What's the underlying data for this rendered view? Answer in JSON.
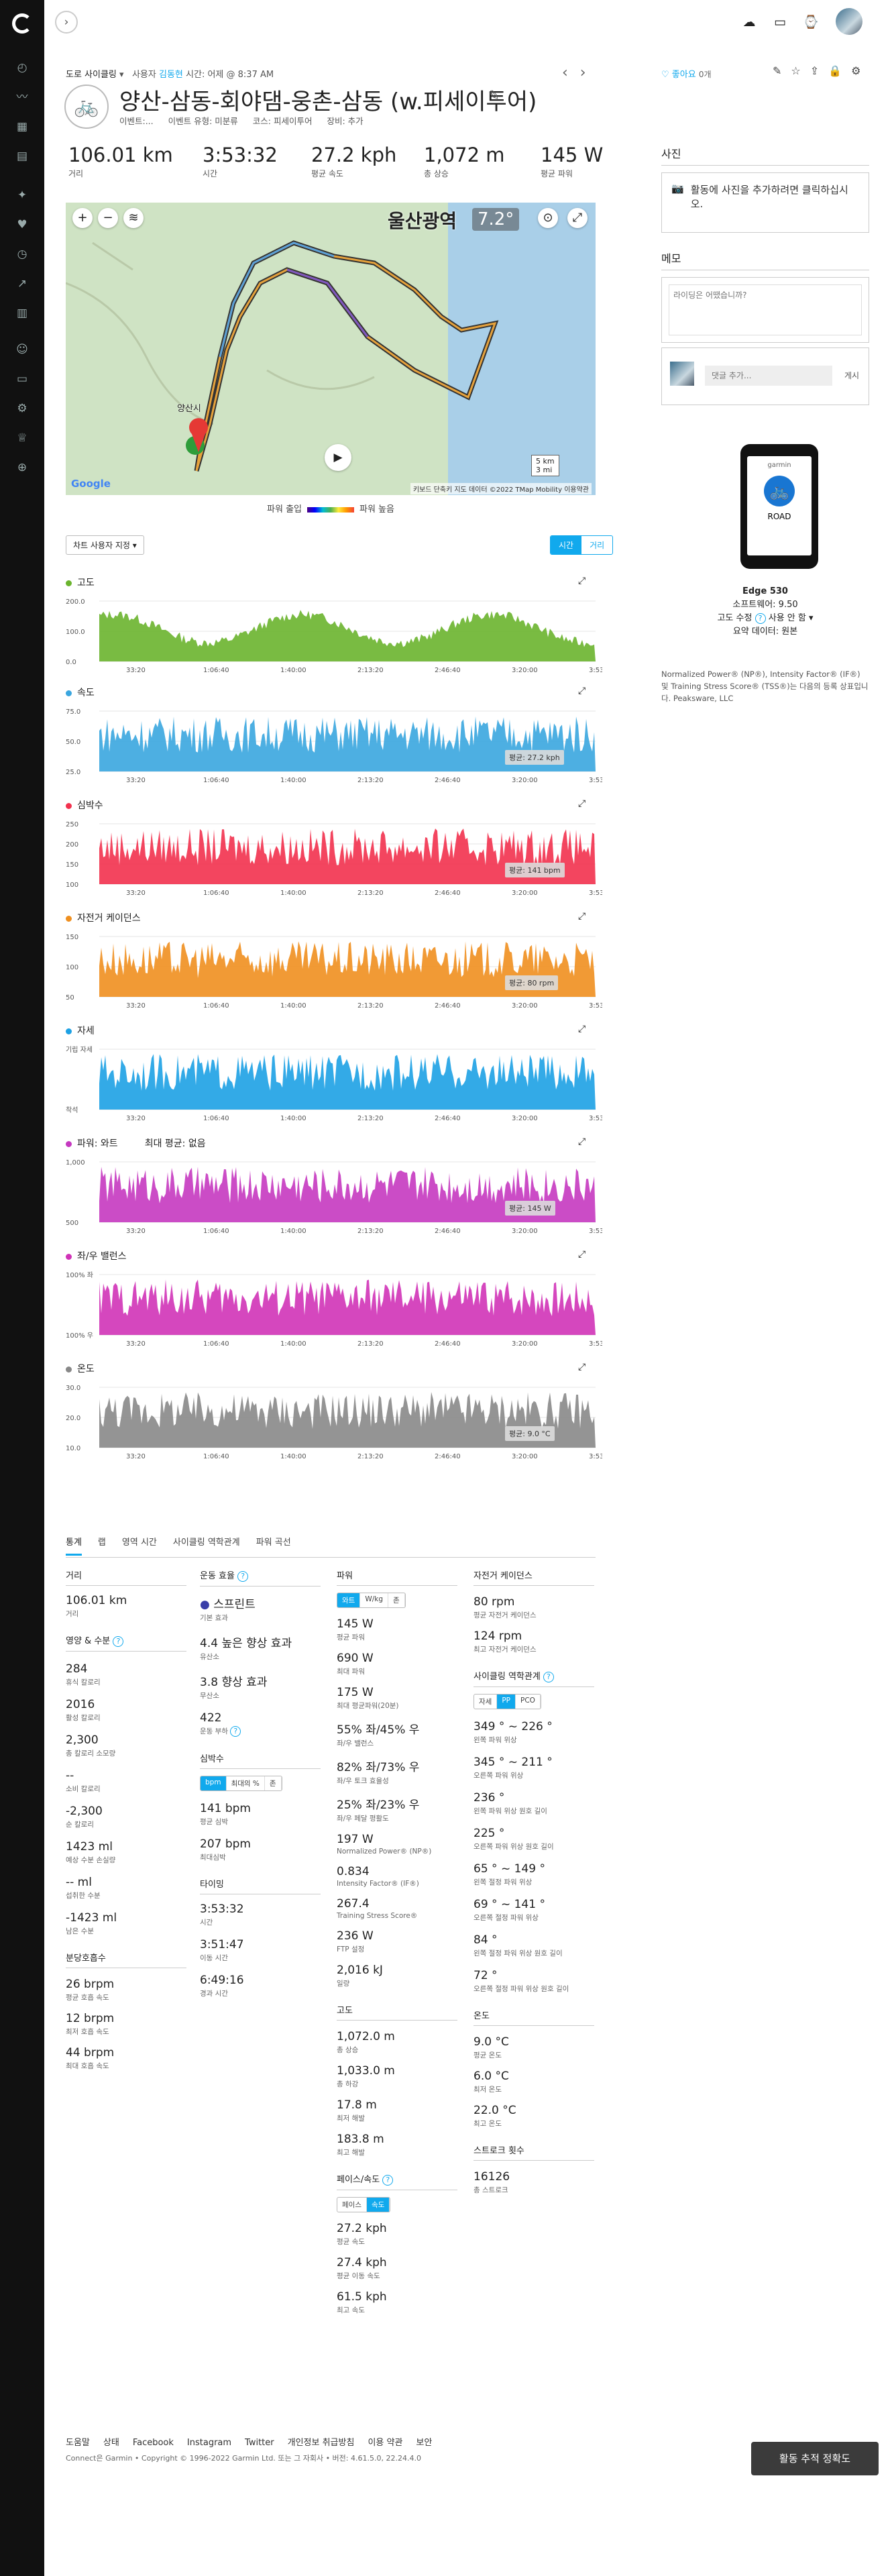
{
  "activity": {
    "breadcrumb_type": "도로 사이클링",
    "breadcrumb_user": "사용자",
    "breadcrumb_user_link": "김동현",
    "breadcrumb_time": "시간: 어제 @ 8:37 AM",
    "title": "양산-삼동-회야댐-웅촌-삼동 (w.피세이투어)",
    "sub_event": "이벤트:...",
    "sub_event_type": "이벤트 유형: 미분류",
    "sub_course": "코스: 피세이투어",
    "sub_gear": "장비: 추가",
    "like": "좋아요",
    "like_count": "0개"
  },
  "stats": [
    {
      "value": "106.01 km",
      "label": "거리"
    },
    {
      "value": "3:53:32",
      "label": "시간"
    },
    {
      "value": "27.2 kph",
      "label": "평균 속도"
    },
    {
      "value": "1,072 m",
      "label": "총 상승"
    },
    {
      "value": "145 W",
      "label": "평균 파워"
    }
  ],
  "map": {
    "city": "울산광역",
    "temp": "7.2°",
    "scale_1": "5 km",
    "scale_2": "3 mi",
    "attribution": "키보드 단축키  지도 데이터 ©2022 TMap Mobility  이용약관",
    "google": "Google",
    "place_1": "양산시",
    "legend_low": "파워 출입",
    "legend_high": "파워 높음"
  },
  "controls": {
    "user_setting": "차트 사용자 지정",
    "time": "시간",
    "distance": "거리"
  },
  "charts": [
    {
      "title": "고도",
      "color": "#6ab42d",
      "y_ticks": [
        "200.0",
        "100.0",
        "0.0"
      ],
      "avg": ""
    },
    {
      "title": "속도",
      "color": "#3aa6df",
      "y_ticks": [
        "75.0",
        "50.0",
        "25.0"
      ],
      "avg": "평균: 27.2 kph"
    },
    {
      "title": "심박수",
      "color": "#f2314e",
      "y_ticks": [
        "250",
        "200",
        "150",
        "100"
      ],
      "avg": "평균: 141 bpm"
    },
    {
      "title": "자전거 케이던스",
      "color": "#ef8f1f",
      "y_ticks": [
        "150",
        "100",
        "50"
      ],
      "avg": "평균: 80 rpm"
    },
    {
      "title": "자세",
      "color": "#1da1e4",
      "y_ticks": [
        "기립 자세",
        "착석"
      ],
      "avg": ""
    },
    {
      "title": "파워: 와트",
      "color": "#c538c0",
      "y_ticks": [
        "1,000",
        "500"
      ],
      "avg": "평균: 145 W",
      "extra": "최대 평균: 없음"
    },
    {
      "title": "좌/우 밸런스",
      "color": "#d033b7",
      "y_ticks": [
        "100% 좌",
        "100% 우"
      ],
      "avg": ""
    },
    {
      "title": "온도",
      "color": "#888888",
      "y_ticks": [
        "30.0",
        "20.0",
        "10.0"
      ],
      "avg": "평균: 9.0 °C"
    }
  ],
  "x_ticks": [
    "33:20",
    "1:06:40",
    "1:40:00",
    "2:13:20",
    "2:46:40",
    "3:20:00",
    "3:53:20"
  ],
  "tabs": [
    "통계",
    "랩",
    "영역 시간",
    "사이클링 역학관계",
    "파워 곡선"
  ],
  "col1": {
    "distance_h": "거리",
    "distance": "106.01 km",
    "distance_l": "거리",
    "nutrition_h": "영양 & 수분",
    "items": [
      {
        "v": "284",
        "l": "휴식 칼로리"
      },
      {
        "v": "2016",
        "l": "활성 칼로리"
      },
      {
        "v": "2,300",
        "l": "총 칼로리 소모량"
      },
      {
        "v": "--",
        "l": "소비 칼로리"
      },
      {
        "v": "-2,300",
        "l": "순 칼로리"
      },
      {
        "v": "1423 ml",
        "l": "예상 수분 손실량"
      },
      {
        "v": "-- ml",
        "l": "섭취한 수분"
      },
      {
        "v": "-1423 ml",
        "l": "남은 수분"
      }
    ],
    "resp_h": "분당호흡수",
    "resp": [
      {
        "v": "26 brpm",
        "l": "평균 호흡 속도"
      },
      {
        "v": "12 brpm",
        "l": "최저 호흡 속도"
      },
      {
        "v": "44 brpm",
        "l": "최대 호흡 속도"
      }
    ]
  },
  "col2": {
    "effect_h": "운동 효율",
    "effect_label": "스프린트",
    "effect_sub": "기본 효과",
    "aerobic": "4.4 높은 향상 효과",
    "aerobic_l": "유산소",
    "anaerobic": "3.8 향상 효과",
    "anaerobic_l": "무산소",
    "load": "422",
    "load_l": "운동 부하",
    "hr_h": "심박수",
    "hr_toggle": [
      "bpm",
      "최대의 %",
      "존"
    ],
    "hr_avg": "141 bpm",
    "hr_avg_l": "평균 심박",
    "hr_max": "207 bpm",
    "hr_max_l": "최대심박",
    "timing_h": "타이밍",
    "time": "3:53:32",
    "time_l": "시간",
    "moving": "3:51:47",
    "moving_l": "이동 시간",
    "elapsed": "6:49:16",
    "elapsed_l": "경과 시간"
  },
  "col3": {
    "power_h": "파워",
    "power_toggle": [
      "와트",
      "W/kg",
      "존"
    ],
    "items": [
      {
        "v": "145 W",
        "l": "평균 파워"
      },
      {
        "v": "690 W",
        "l": "최대 파워"
      },
      {
        "v": "175 W",
        "l": "최대 평균파워(20분)"
      },
      {
        "v": "55% 좌/45% 우",
        "l": "좌/우 밸런스"
      },
      {
        "v": "82% 좌/73% 우",
        "l": "좌/우 토크 효율성"
      },
      {
        "v": "25% 좌/23% 우",
        "l": "좌/우 페달 평활도"
      },
      {
        "v": "197 W",
        "l": "Normalized Power® (NP®)"
      },
      {
        "v": "0.834",
        "l": "Intensity Factor® (IF®)"
      },
      {
        "v": "267.4",
        "l": "Training Stress Score®"
      },
      {
        "v": "236 W",
        "l": "FTP 설정"
      },
      {
        "v": "2,016 kJ",
        "l": "일량"
      }
    ],
    "elev_h": "고도",
    "elev": [
      {
        "v": "1,072.0 m",
        "l": "총 상승"
      },
      {
        "v": "1,033.0 m",
        "l": "총 하강"
      },
      {
        "v": "17.8 m",
        "l": "최저 해발"
      },
      {
        "v": "183.8 m",
        "l": "최고 해발"
      }
    ],
    "pace_h": "페이스/속도",
    "pace_toggle": [
      "페이스",
      "속도"
    ],
    "pace": [
      {
        "v": "27.2 kph",
        "l": "평균 속도"
      },
      {
        "v": "27.4 kph",
        "l": "평균 이동 속도"
      },
      {
        "v": "61.5 kph",
        "l": "최고 속도"
      }
    ]
  },
  "col4": {
    "cad_h": "자전거 케이던스",
    "cad": [
      {
        "v": "80 rpm",
        "l": "평균 자전거 케이던스"
      },
      {
        "v": "124 rpm",
        "l": "최고 자전거 케이던스"
      }
    ],
    "dyn_h": "사이클링 역학관계",
    "dyn_toggle": [
      "자세",
      "PP",
      "PCO"
    ],
    "dyn": [
      {
        "v": "349 ° ~ 226 °",
        "l": "왼쪽 파워 위상"
      },
      {
        "v": "345 ° ~ 211 °",
        "l": "오른쪽 파워 위상"
      },
      {
        "v": "236 °",
        "l": "왼쪽 파워 위상 원호 길이"
      },
      {
        "v": "225 °",
        "l": "오른쪽 파워 위상 원호 길이"
      },
      {
        "v": "65 ° ~ 149 °",
        "l": "왼쪽 절정 파워 위상"
      },
      {
        "v": "69 ° ~ 141 °",
        "l": "오른쪽 절정 파워 위상"
      },
      {
        "v": "84 °",
        "l": "왼쪽 절정 파워 위상 원호 길이"
      },
      {
        "v": "72 °",
        "l": "오른쪽 절정 파워 위상 원호 길이"
      }
    ],
    "temp_h": "온도",
    "temp": [
      {
        "v": "9.0 °C",
        "l": "평균 온도"
      },
      {
        "v": "6.0 °C",
        "l": "최저 온도"
      },
      {
        "v": "22.0 °C",
        "l": "최고 온도"
      }
    ],
    "strokes_h": "스트로크 횟수",
    "strokes": [
      {
        "v": "16126",
        "l": "총 스트로크"
      }
    ]
  },
  "right": {
    "photos_h": "사진",
    "photos_add": "활동에 사진을 추가하려면 클릭하십시오.",
    "notes_h": "메모",
    "notes_placeholder": "라이딩은 어땠습니까?",
    "comment_placeholder": "댓글 추가...",
    "comment_post": "게시",
    "device_name": "Edge 530",
    "software": "소프트웨어: 9.50",
    "elev_corr": "고도 수정",
    "elev_corr_val": "사용 안 함",
    "summary_data": "요약 데이터: 원본",
    "screen_top": "garmin",
    "screen_mode": "ROAD",
    "trademark": "Normalized Power® (NP®), Intensity Factor® (IF®) 및 Training Stress Score® (TSS®)는 다음의 등록 상표입니다. Peaksware, LLC"
  },
  "footer": {
    "links": [
      "도움말",
      "상태",
      "Facebook",
      "Instagram",
      "Twitter",
      "개인정보 취급방침",
      "이용 약관",
      "보안"
    ],
    "copyright": "Connect은 Garmin • Copyright © 1996-2022 Garmin Ltd. 또는 그 자회사 • 버전: 4.61.5.0, 22.24.4.0",
    "track_button": "활동 추적 정확도"
  }
}
